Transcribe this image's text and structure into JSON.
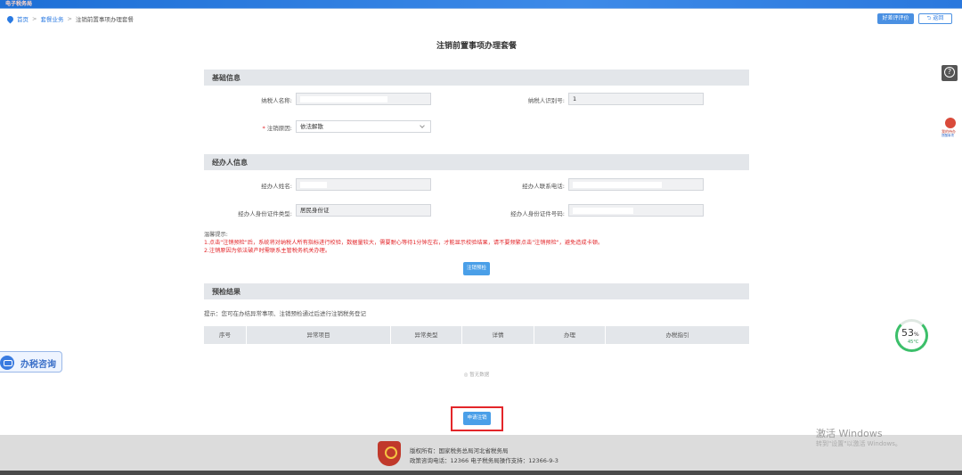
{
  "app": {
    "logo": "电子税务局"
  },
  "breadcrumb": {
    "home": "首页",
    "category": "套餐业务",
    "current": "注销前置事项办理套餐",
    "sep": ">"
  },
  "header": {
    "eval_label": "好差评评价",
    "back_label": "返回"
  },
  "page_title": "注销前置事项办理套餐",
  "basic": {
    "title": "基础信息",
    "name_label": "纳税人名称:",
    "id_label": "纳税人识别号:",
    "id_prefix": "1",
    "reason_label": "注销原因:",
    "reason_value": "依法解散"
  },
  "agent": {
    "title": "经办人信息",
    "name_label": "经办人姓名:",
    "phone_label": "经办人联系电话:",
    "idtype_label": "经办人身份证件类型:",
    "idtype_value": "居民身份证",
    "idno_label": "经办人身份证件号码:"
  },
  "tips": {
    "head": "温馨提示:",
    "line1": "1.点击\"注销预检\"后，系统将对纳税人所有指标进行校验，数据量较大，需要耐心等待1分钟左右，才能显示校验结果，请不要频繁点击\"注销预检\"，避免造成卡顿。",
    "line2": "2.注销原因为依法破产时需联系主管税务机关办理。"
  },
  "check_button": "注销预检",
  "result": {
    "title": "预检结果",
    "hint": "提示：您可在办结异常事项、注销预检通过后进行注销税务登记",
    "columns": [
      "序号",
      "异常项目",
      "异常类型",
      "详情",
      "办理",
      "办税指引"
    ],
    "empty": "◎ 暂无数据"
  },
  "apply_button": "申请注销",
  "footer": {
    "line1": "版权所有：国家税务总局河北省税务局",
    "line2": "政策咨询电话：12366    电子税务局操作支持：12366-9-3"
  },
  "consult": {
    "label": "办税咨询"
  },
  "badge": {
    "line1": "我的待办",
    "line2": "提醒事项"
  },
  "gauge": {
    "value": "53",
    "unit": "%",
    "temp": "45°C",
    "level": 0.53
  },
  "watermark": {
    "line1": "激活 Windows",
    "line2": "转到\"设置\"以激活 Windows。"
  },
  "colors": {
    "accent": "#4a90e2",
    "required": "#e3262a",
    "highlight": "#e3262a"
  }
}
